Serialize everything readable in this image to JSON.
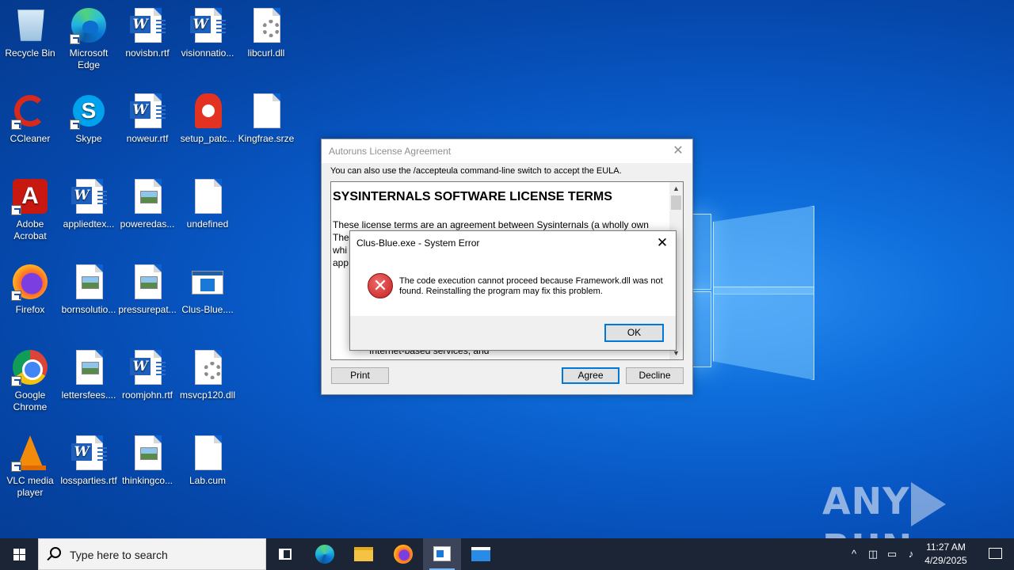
{
  "desktop": {
    "icons": [
      {
        "label": "Recycle Bin"
      },
      {
        "label": "Microsoft Edge"
      },
      {
        "label": "novisbn.rtf"
      },
      {
        "label": "visionnatio..."
      },
      {
        "label": "libcurl.dll"
      },
      {
        "label": "CCleaner"
      },
      {
        "label": "Skype"
      },
      {
        "label": "noweur.rtf"
      },
      {
        "label": "setup_patc..."
      },
      {
        "label": "Kingfrae.srze"
      },
      {
        "label": "Adobe Acrobat"
      },
      {
        "label": "appliedtex..."
      },
      {
        "label": "poweredas..."
      },
      {
        "label": "undefined"
      },
      {
        "label": "Firefox"
      },
      {
        "label": "bornsolutio..."
      },
      {
        "label": "pressurepat..."
      },
      {
        "label": "Clus-Blue...."
      },
      {
        "label": "Google Chrome"
      },
      {
        "label": "lettersfees...."
      },
      {
        "label": "roomjohn.rtf"
      },
      {
        "label": "msvcp120.dll"
      },
      {
        "label": "VLC media player"
      },
      {
        "label": "lossparties.rtf"
      },
      {
        "label": "thinkingco..."
      },
      {
        "label": "Lab.cum"
      }
    ]
  },
  "autoruns_dialog": {
    "title": "Autoruns License Agreement",
    "info": "You can also use the /accepteula command-line switch to accept the EULA.",
    "eula_title": "SYSINTERNALS SOFTWARE LICENSE TERMS",
    "eula_text": "These license terms are an agreement between Sysinternals (a wholly own",
    "eula_line2": "The",
    "eula_line3": "whi",
    "eula_line4": "app",
    "eula_bottom": "Internet-based services, and",
    "print_label": "Print",
    "agree_label": "Agree",
    "decline_label": "Decline"
  },
  "error_dialog": {
    "title": "Clus-Blue.exe - System Error",
    "message": "The code execution cannot proceed because Framework.dll was not found. Reinstalling the program may fix this problem.",
    "ok_label": "OK"
  },
  "watermark": {
    "left": "ANY",
    "right": "RUN"
  },
  "taskbar": {
    "search_placeholder": "Type here to search",
    "time": "11:27 AM",
    "date": "4/29/2025"
  },
  "colors": {
    "accent": "#0078d7",
    "taskbar": "#1c2536",
    "error_red": "#c42020"
  }
}
